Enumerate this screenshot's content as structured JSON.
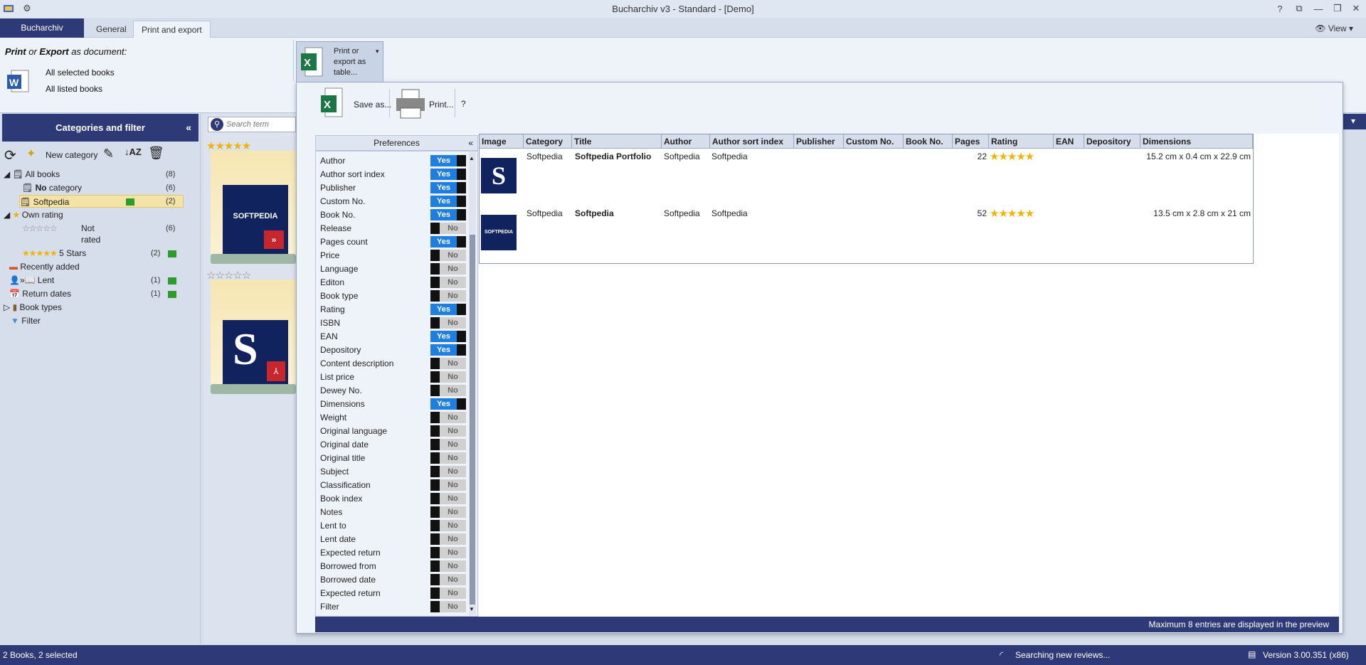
{
  "window": {
    "title": "Bucharchiv v3 - Standard - [Demo]"
  },
  "tabs": {
    "app": "Bucharchiv",
    "general": "General",
    "print_export": "Print and export",
    "view": "View"
  },
  "ribbon": {
    "print_label_print": "Print",
    "print_label_or": " or ",
    "print_label_export": "Export",
    "print_label_rest": " as document:",
    "selected_books": "All selected books",
    "listed_books": "All listed books",
    "print_export_table_btn": "Print or export as table..."
  },
  "left_panel": {
    "title": "Categories and filter",
    "new_category": "New category",
    "tree": {
      "all_books": "All books",
      "all_books_count": "(8)",
      "no_category_bold": "No",
      "no_category_rest": " category",
      "no_category_count": "(6)",
      "softpedia": "Softpedia",
      "softpedia_count": "(2)",
      "own_rating": "Own rating",
      "not_rated_1": "Not",
      "not_rated_2": "rated",
      "not_rated_count": "(6)",
      "five_stars": "5 Stars",
      "five_stars_count": "(2)",
      "recently_added": "Recently added",
      "lent": "Lent",
      "lent_count": "(1)",
      "return_dates": "Return dates",
      "return_dates_count": "(1)",
      "book_types": "Book types",
      "filter": "Filter"
    }
  },
  "search": {
    "placeholder": "Search term"
  },
  "covers": {
    "cover1_text": "SOFTPEDIA"
  },
  "dialog": {
    "save_as": "Save as...",
    "print": "Print...",
    "help": "?",
    "preferences_title": "Preferences",
    "preferences": [
      {
        "label": "Author",
        "on": true
      },
      {
        "label": "Author sort index",
        "on": true
      },
      {
        "label": "Publisher",
        "on": true
      },
      {
        "label": "Custom No.",
        "on": true
      },
      {
        "label": "Book No.",
        "on": true
      },
      {
        "label": "Release",
        "on": false
      },
      {
        "label": "Pages count",
        "on": true
      },
      {
        "label": "Price",
        "on": false
      },
      {
        "label": "Language",
        "on": false
      },
      {
        "label": "Editon",
        "on": false
      },
      {
        "label": "Book type",
        "on": false
      },
      {
        "label": "Rating",
        "on": true
      },
      {
        "label": "ISBN",
        "on": false
      },
      {
        "label": "EAN",
        "on": true
      },
      {
        "label": "Depository",
        "on": true
      },
      {
        "label": "Content description",
        "on": false
      },
      {
        "label": "List price",
        "on": false
      },
      {
        "label": "Dewey No.",
        "on": false
      },
      {
        "label": "Dimensions",
        "on": true
      },
      {
        "label": "Weight",
        "on": false
      },
      {
        "label": "Original language",
        "on": false
      },
      {
        "label": "Original date",
        "on": false
      },
      {
        "label": "Original title",
        "on": false
      },
      {
        "label": "Subject",
        "on": false
      },
      {
        "label": "Classification",
        "on": false
      },
      {
        "label": "Book index",
        "on": false
      },
      {
        "label": "Notes",
        "on": false
      },
      {
        "label": "Lent to",
        "on": false
      },
      {
        "label": "Lent date",
        "on": false
      },
      {
        "label": "Expected return",
        "on": false
      },
      {
        "label": "Borrowed from",
        "on": false
      },
      {
        "label": "Borrowed date",
        "on": false
      },
      {
        "label": "Expected return",
        "on": false
      },
      {
        "label": "Filter",
        "on": false
      }
    ],
    "yes_label": "Yes",
    "no_label": "No",
    "table": {
      "headers": [
        "Image",
        "Category",
        "Title",
        "Author",
        "Author sort index",
        "Publisher",
        "Custom No.",
        "Book No.",
        "Pages",
        "Rating",
        "EAN",
        "Depository",
        "Dimensions"
      ],
      "rows": [
        {
          "category": "Softpedia",
          "title": "Softpedia Portfolio",
          "author": "Softpedia",
          "author_sort": "Softpedia",
          "pages": "22",
          "rating": 5,
          "dimensions": "15.2 cm x 0.4 cm x 22.9 cm",
          "image_text": "S"
        },
        {
          "category": "Softpedia",
          "title": "Softpedia",
          "author": "Softpedia",
          "author_sort": "Softpedia",
          "pages": "52",
          "rating": 5,
          "dimensions": "13.5 cm x 2.8 cm x 21 cm",
          "image_text": "SOFTPEDIA"
        }
      ]
    },
    "footer": "Maximum 8 entries are displayed in the preview"
  },
  "status": {
    "selection": "2 Books, 2 selected",
    "searching": "Searching new reviews...",
    "version": "Version 3.00.351 (x86)"
  },
  "colors": {
    "accent": "#2e3a78",
    "toggle_on": "#1e7fe0",
    "star": "#f0b400"
  }
}
